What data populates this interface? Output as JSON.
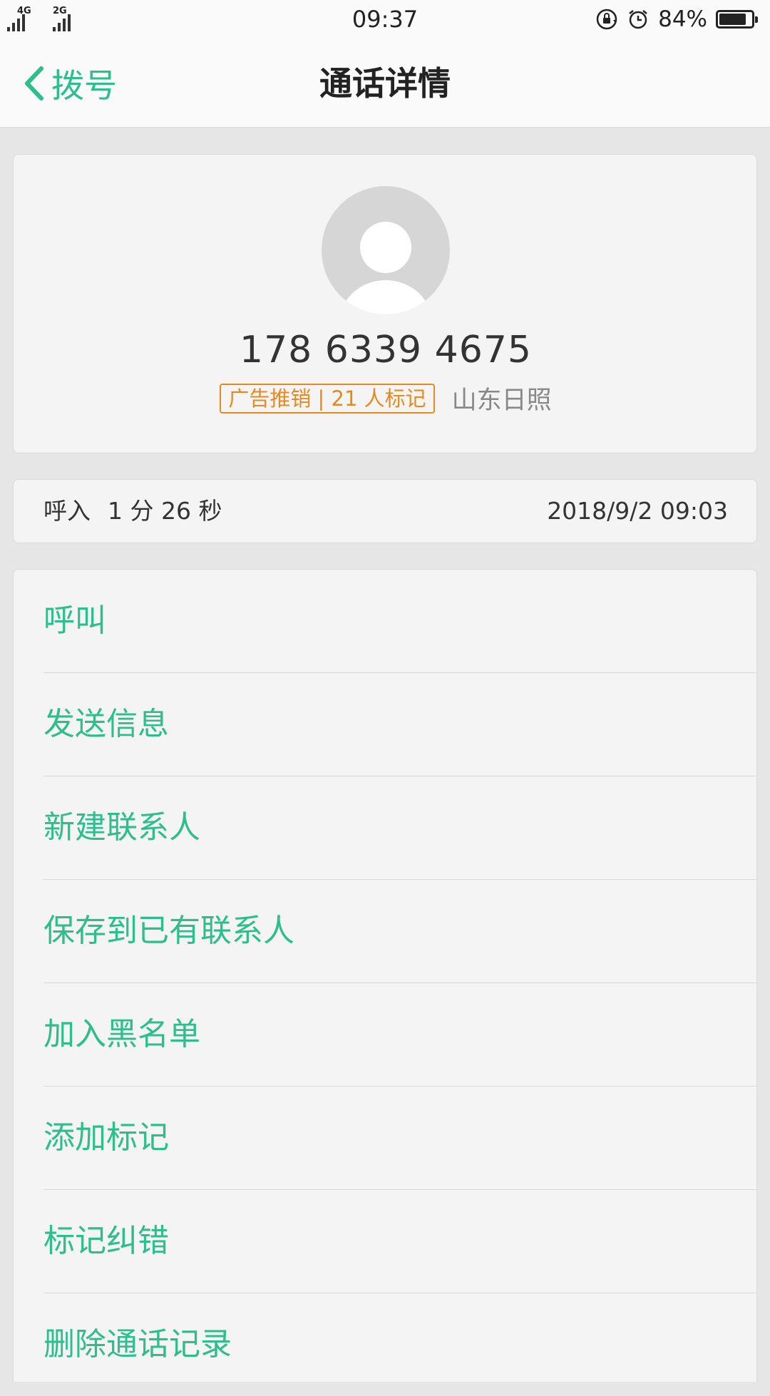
{
  "status_bar": {
    "network_1": "4G",
    "network_2": "2G",
    "time": "09:37",
    "battery_percent": "84%",
    "battery_level": 0.84,
    "icons": [
      "rotation-lock-icon",
      "alarm-icon",
      "battery-icon"
    ]
  },
  "nav": {
    "back_label": "拨号",
    "title": "通话详情",
    "accent_color": "#2ebd8c"
  },
  "contact": {
    "number": "178 6339 4675",
    "tag": "广告推销 | 21 人标记",
    "tag_color": "#e58a1f",
    "location": "山东日照"
  },
  "call_record": {
    "type": "呼入",
    "duration": "1 分 26 秒",
    "datetime": "2018/9/2 09:03"
  },
  "actions": [
    {
      "label": "呼叫"
    },
    {
      "label": "发送信息"
    },
    {
      "label": "新建联系人"
    },
    {
      "label": "保存到已有联系人"
    },
    {
      "label": "加入黑名单"
    },
    {
      "label": "添加标记"
    },
    {
      "label": "标记纠错"
    },
    {
      "label": "删除通话记录"
    }
  ]
}
